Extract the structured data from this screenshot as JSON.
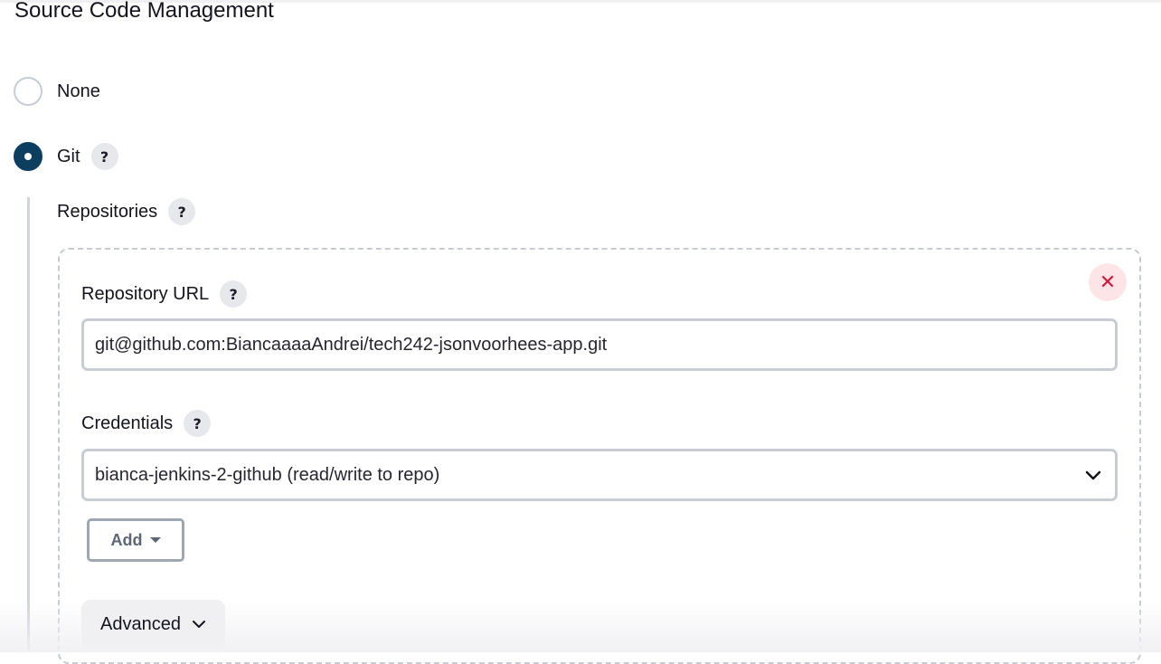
{
  "section": {
    "title": "Source Code Management"
  },
  "scm_options": {
    "none_label": "None",
    "git_label": "Git",
    "selected": "Git"
  },
  "git": {
    "repositories_label": "Repositories",
    "repository": {
      "url_label": "Repository URL",
      "url_value": "git@github.com:BiancaaaaAndrei/tech242-jsonvoorhees-app.git",
      "credentials_label": "Credentials",
      "credentials_selected": "bianca-jenkins-2-github (read/write to repo)",
      "add_label": "Add",
      "advanced_label": "Advanced",
      "close_icon": "close-icon"
    }
  },
  "help_glyph": "?",
  "colors": {
    "accent": "#0b3e5f",
    "danger": "#d4183a",
    "danger_bg": "#fde4e7",
    "help_bg": "#e7e8ec",
    "border": "#c8ccd3"
  }
}
